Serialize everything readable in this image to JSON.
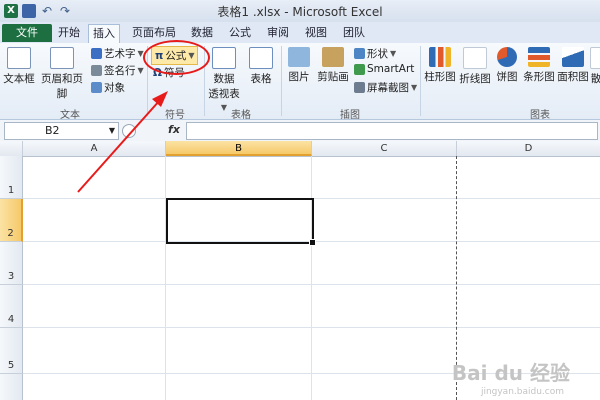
{
  "title_bar": {
    "app_logo": "X",
    "undo_glyph": "↶",
    "redo_glyph": "↷",
    "title": "表格1 .xlsx - Microsoft Excel"
  },
  "tabs": [
    {
      "id": "file",
      "label": "文件"
    },
    {
      "id": "home",
      "label": "开始"
    },
    {
      "id": "insert",
      "label": "插入",
      "active": true
    },
    {
      "id": "layout",
      "label": "页面布局"
    },
    {
      "id": "data",
      "label": "数据"
    },
    {
      "id": "formulas",
      "label": "公式"
    },
    {
      "id": "review",
      "label": "审阅"
    },
    {
      "id": "view",
      "label": "视图"
    },
    {
      "id": "team",
      "label": "团队"
    }
  ],
  "ribbon": {
    "text_group": {
      "label": "文本",
      "textbox": "文本框",
      "header_footer": "页眉和页脚",
      "wordart": "艺术字",
      "signature": "签名行",
      "object": "对象"
    },
    "symbols_group": {
      "label": "符号",
      "equation": "公式",
      "equation_icon": "π",
      "symbol": "符号",
      "symbol_icon": "Ω"
    },
    "tables_group": {
      "label": "表格",
      "pivot_line1": "数据",
      "pivot_line2": "透视表",
      "table": "表格"
    },
    "illustrations_group": {
      "label": "插图",
      "picture": "图片",
      "clipart": "剪贴画",
      "shapes": "形状",
      "smartart": "SmartArt",
      "screenshot": "屏幕截图"
    },
    "charts_group": {
      "label": "图表",
      "column": "柱形图",
      "line": "折线图",
      "pie": "饼图",
      "bar": "条形图",
      "area": "面积图",
      "scatter": "散"
    }
  },
  "formula_bar": {
    "name_box": "B2",
    "fx": "fx",
    "formula": ""
  },
  "grid": {
    "columns": [
      "A",
      "B",
      "C",
      "D"
    ],
    "rows": [
      "1",
      "2",
      "3",
      "4",
      "5"
    ],
    "active_cell": "B2"
  },
  "watermark": {
    "brand": "Bai du 经验",
    "url": "jingyan.baidu.com"
  },
  "colors": {
    "file_tab": "#1d6f42",
    "selection_header": "#f6c96a",
    "annotation_red": "#e81b1b"
  }
}
